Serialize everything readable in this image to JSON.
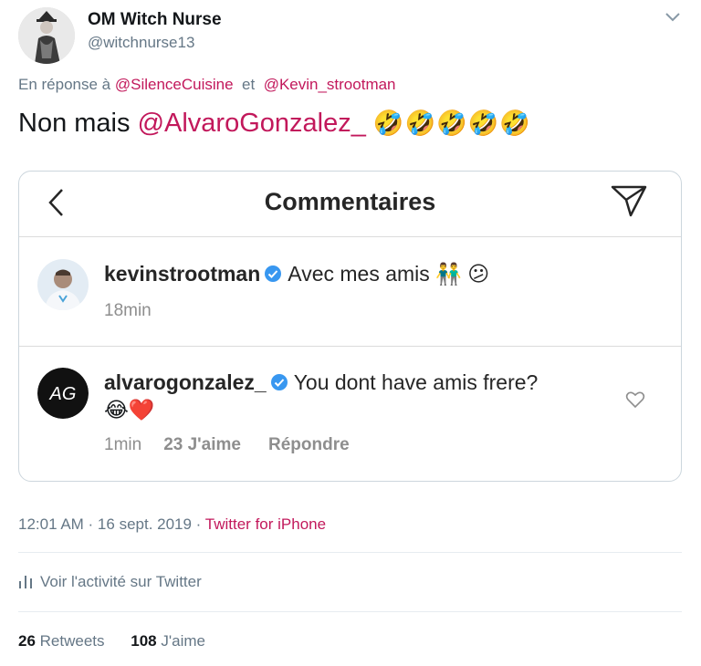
{
  "author": {
    "name": "OM Witch Nurse",
    "handle": "@witchnurse13"
  },
  "reply": {
    "prefix": "En réponse à",
    "mention1": "@SilenceCuisine",
    "connector": "et",
    "mention2": "@Kevin_strootman"
  },
  "tweet": {
    "text_prefix": "Non mais",
    "mention": "@AlvaroGonzalez_",
    "emojis": "🤣🤣🤣🤣🤣"
  },
  "card": {
    "title": "Commentaires",
    "comments": [
      {
        "user": "kevinstrootman",
        "text": "Avec mes amis",
        "emojis": "👬 😕",
        "time": "18min"
      },
      {
        "user": "alvarogonzalez_",
        "text": "You dont have amis frere?",
        "emojis": "😂❤️",
        "time": "1min",
        "likes": "23 J'aime",
        "reply": "Répondre",
        "avatar_text": "AG"
      }
    ]
  },
  "meta": {
    "timestamp": "12:01 AM · 16 sept. 2019 ·",
    "source": "Twitter for iPhone",
    "activity": "Voir l'activité sur Twitter"
  },
  "stats": {
    "retweets_count": "26",
    "retweets_label": "Retweets",
    "likes_count": "108",
    "likes_label": "J'aime"
  },
  "colors": {
    "accent": "#c2185b",
    "muted": "#657786",
    "verified": "#3897f0"
  }
}
